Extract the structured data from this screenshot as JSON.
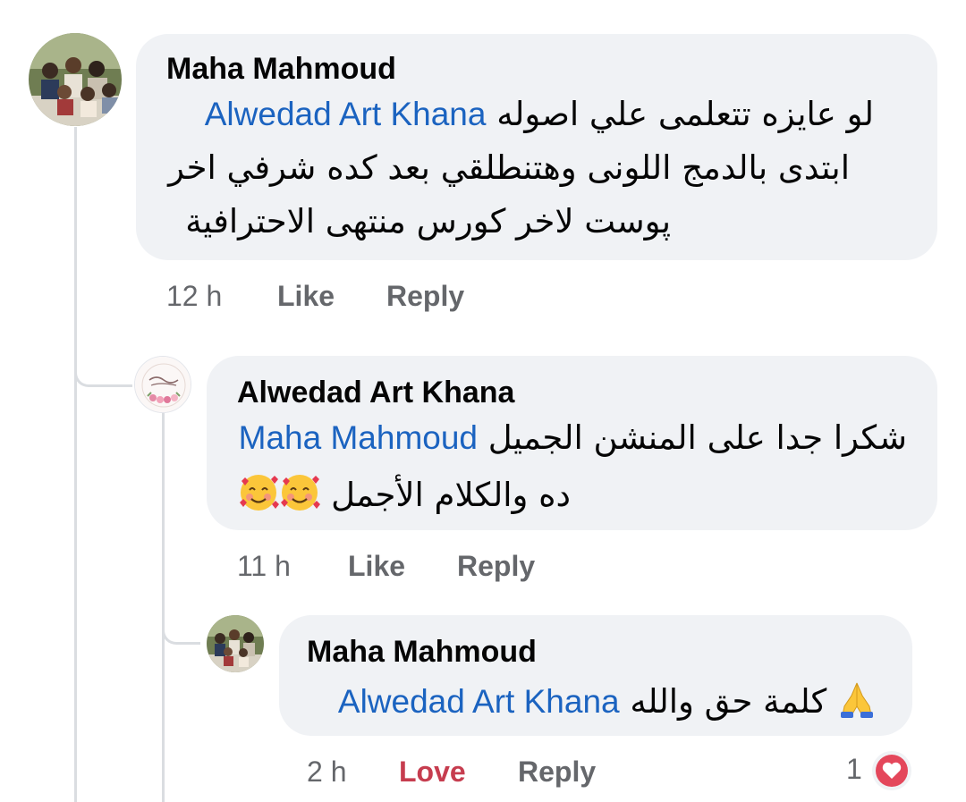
{
  "comments": [
    {
      "author": "Maha Mahmoud",
      "mention": "Alwedad Art Khana",
      "line1_text": "لو عايزه تتعلمى علي اصوله",
      "line2": "ابتدى بالدمج اللونى وهتنطلقي بعد كده شرفي اخر",
      "line3": "پوست لاخر كورس منتهى الاحترافية",
      "time": "12 h",
      "like": "Like",
      "reply": "Reply"
    },
    {
      "author": "Alwedad Art Khana",
      "mention": "Maha Mahmoud",
      "line1_text": "شكرا جدا على المنشن الجميل",
      "line2_text": "ده والكلام الأجمل",
      "emojis": [
        "smiling-face-with-hearts-icon",
        "smiling-face-with-hearts-icon"
      ],
      "time": "11 h",
      "like": "Like",
      "reply": "Reply"
    },
    {
      "author": "Maha Mahmoud",
      "mention": "Alwedad Art Khana",
      "line1_text": "كلمة حق والله",
      "emoji": "folded-hands-icon",
      "time": "2 h",
      "like": "Love",
      "reply": "Reply",
      "reaction_count": "1",
      "reaction_icon": "love-reaction-icon"
    }
  ],
  "colors": {
    "bubble": "#f0f2f5",
    "mention": "#1b63c0",
    "meta": "#65676b",
    "love": "#c63d4f",
    "thread": "#dadde1"
  }
}
